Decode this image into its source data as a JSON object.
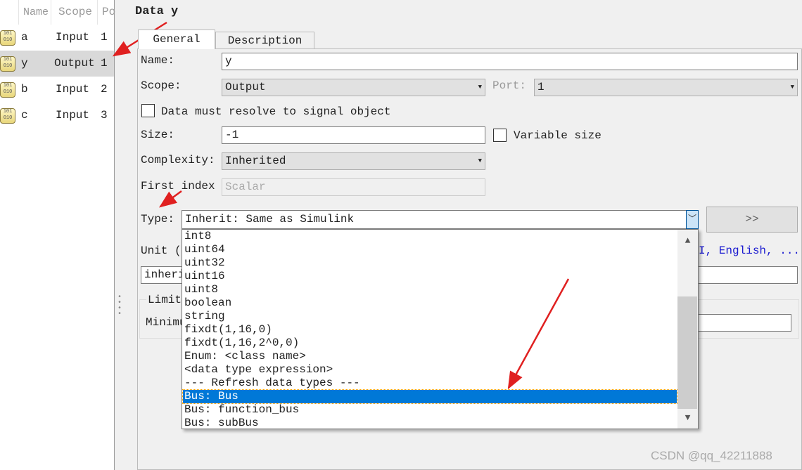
{
  "left_panel": {
    "columns": [
      "Name",
      "Scope",
      "Po"
    ],
    "rows": [
      {
        "name": "a",
        "scope": "Input",
        "port": "1"
      },
      {
        "name": "y",
        "scope": "Output",
        "port": "1",
        "selected": true
      },
      {
        "name": "b",
        "scope": "Input",
        "port": "2"
      },
      {
        "name": "c",
        "scope": "Input",
        "port": "3"
      }
    ],
    "icon": "data-variable-icon",
    "icon_text": "101 010"
  },
  "title": "Data y",
  "tabs": [
    {
      "label": "General",
      "active": true
    },
    {
      "label": "Description"
    }
  ],
  "form": {
    "name_label": "Name:",
    "name_value": "y",
    "scope_label": "Scope:",
    "scope_value": "Output",
    "port_label": "Port:",
    "port_value": "1",
    "resolve_label": "Data must resolve to signal object",
    "resolve_checked": false,
    "size_label": "Size:",
    "size_value": "-1",
    "variable_size_label": "Variable size",
    "variable_size_checked": false,
    "complexity_label": "Complexity:",
    "complexity_value": "Inherited",
    "first_index_label": "First index",
    "first_index_value": "Scalar",
    "type_label": "Type:",
    "type_value": "Inherit: Same as Simulink",
    "assistant_button": ">>",
    "unit_label": "Unit (",
    "unit_link": "I, English, ...",
    "unit_value": "inheri",
    "limit_label": "Limit",
    "minimum_label": "Minimu"
  },
  "dropdown": {
    "items": [
      "int8",
      "uint64",
      "uint32",
      "uint16",
      "uint8",
      "boolean",
      "string",
      "fixdt(1,16,0)",
      "fixdt(1,16,2^0,0)",
      "Enum: <class name>",
      "<data type expression>",
      "--- Refresh data types ---",
      "Bus: Bus",
      "Bus: function_bus",
      "Bus: subBus"
    ],
    "selected": "Bus: Bus",
    "selected_color": "#0078d7"
  },
  "watermark": "CSDN @qq_42211888",
  "annotation_color": "#e02020"
}
